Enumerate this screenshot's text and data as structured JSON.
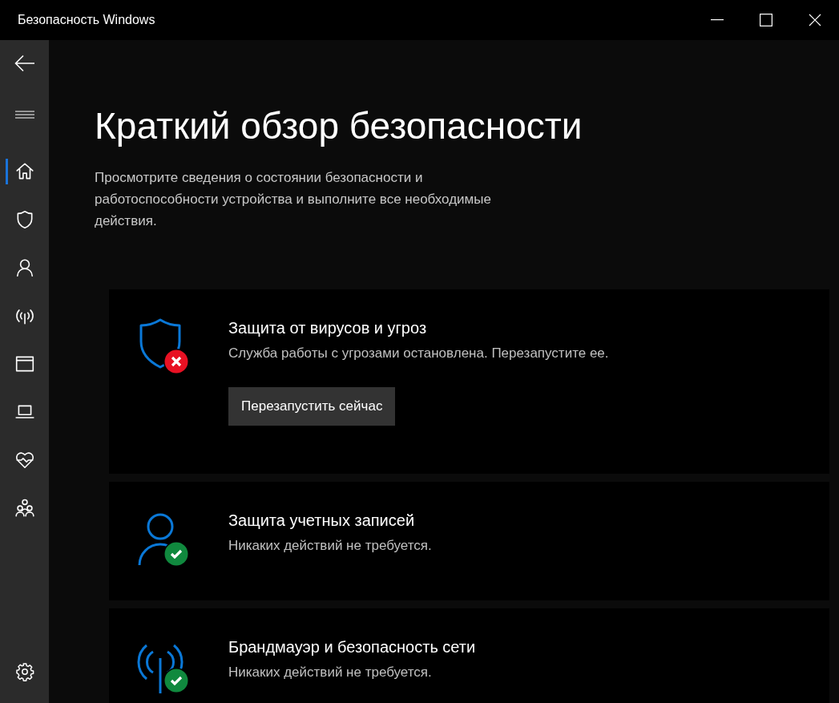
{
  "window": {
    "title": "Безопасность Windows"
  },
  "sidebar": {
    "items": [
      {
        "kind": "home",
        "selected": true
      },
      {
        "kind": "shield",
        "selected": false
      },
      {
        "kind": "person",
        "selected": false
      },
      {
        "kind": "antenna",
        "selected": false
      },
      {
        "kind": "window",
        "selected": false
      },
      {
        "kind": "laptop",
        "selected": false
      },
      {
        "kind": "heart",
        "selected": false
      },
      {
        "kind": "family",
        "selected": false
      }
    ]
  },
  "page": {
    "title": "Краткий обзор безопасности",
    "description": "Просмотрите сведения о состоянии безопасности и работоспособности устройства и выполните все необходимые действия."
  },
  "cards": [
    {
      "kind": "shield",
      "alert": true,
      "title": "Защита от вирусов и угроз",
      "subtitle": "Служба работы с угрозами остановлена. Перезапустите ее.",
      "button": "Перезапустить сейчас"
    },
    {
      "kind": "person",
      "alert": false,
      "title": "Защита учетных записей",
      "subtitle": "Никаких действий не требуется."
    },
    {
      "kind": "antenna",
      "alert": false,
      "title": "Брандмауэр и безопасность сети",
      "subtitle": "Никаких действий не требуется."
    }
  ]
}
